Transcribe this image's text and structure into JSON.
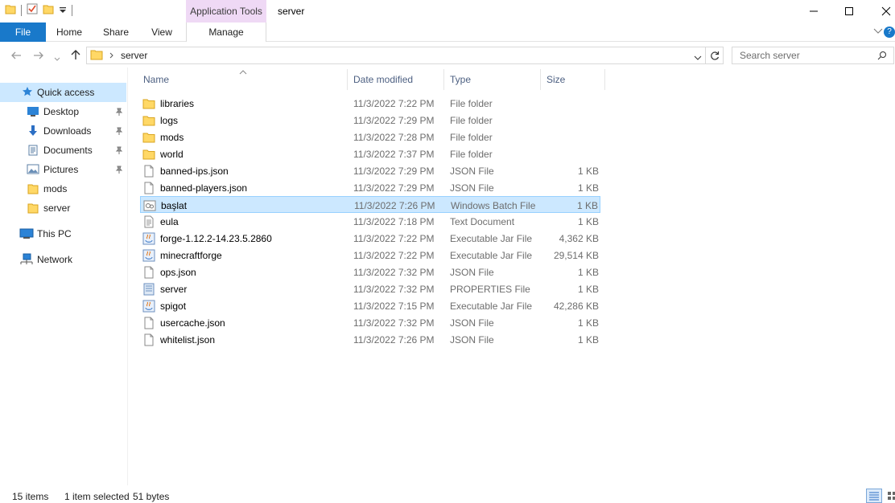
{
  "titlebar": {
    "context_tab": "Application Tools",
    "window_title": "server"
  },
  "ribbon": {
    "tabs": [
      "File",
      "Home",
      "Share",
      "View"
    ],
    "manage": "Manage"
  },
  "address": {
    "path": "server",
    "search_placeholder": "Search server"
  },
  "sidebar": {
    "items": [
      {
        "label": "Quick access",
        "icon": "star-icon"
      },
      {
        "label": "Desktop",
        "icon": "desktop-icon",
        "pinned": true
      },
      {
        "label": "Downloads",
        "icon": "download-icon",
        "pinned": true
      },
      {
        "label": "Documents",
        "icon": "documents-icon",
        "pinned": true
      },
      {
        "label": "Pictures",
        "icon": "pictures-icon",
        "pinned": true
      },
      {
        "label": "mods",
        "icon": "folder-icon"
      },
      {
        "label": "server",
        "icon": "folder-icon"
      },
      {
        "label": "This PC",
        "icon": "computer-icon"
      },
      {
        "label": "Network",
        "icon": "network-icon"
      }
    ]
  },
  "columns": [
    "Name",
    "Date modified",
    "Type",
    "Size"
  ],
  "files": [
    {
      "name": "libraries",
      "date": "11/3/2022 7:22 PM",
      "type": "File folder",
      "size": "",
      "icon": "folder"
    },
    {
      "name": "logs",
      "date": "11/3/2022 7:29 PM",
      "type": "File folder",
      "size": "",
      "icon": "folder"
    },
    {
      "name": "mods",
      "date": "11/3/2022 7:28 PM",
      "type": "File folder",
      "size": "",
      "icon": "folder"
    },
    {
      "name": "world",
      "date": "11/3/2022 7:37 PM",
      "type": "File folder",
      "size": "",
      "icon": "folder"
    },
    {
      "name": "banned-ips.json",
      "date": "11/3/2022 7:29 PM",
      "type": "JSON File",
      "size": "1 KB",
      "icon": "file"
    },
    {
      "name": "banned-players.json",
      "date": "11/3/2022 7:29 PM",
      "type": "JSON File",
      "size": "1 KB",
      "icon": "file"
    },
    {
      "name": "başlat",
      "date": "11/3/2022 7:26 PM",
      "type": "Windows Batch File",
      "size": "1 KB",
      "icon": "batch",
      "selected": true
    },
    {
      "name": "eula",
      "date": "11/3/2022 7:18 PM",
      "type": "Text Document",
      "size": "1 KB",
      "icon": "text"
    },
    {
      "name": "forge-1.12.2-14.23.5.2860",
      "date": "11/3/2022 7:22 PM",
      "type": "Executable Jar File",
      "size": "4,362 KB",
      "icon": "jar"
    },
    {
      "name": "minecraftforge",
      "date": "11/3/2022 7:22 PM",
      "type": "Executable Jar File",
      "size": "29,514 KB",
      "icon": "jar"
    },
    {
      "name": "ops.json",
      "date": "11/3/2022 7:32 PM",
      "type": "JSON File",
      "size": "1 KB",
      "icon": "file"
    },
    {
      "name": "server",
      "date": "11/3/2022 7:32 PM",
      "type": "PROPERTIES File",
      "size": "1 KB",
      "icon": "properties"
    },
    {
      "name": "spigot",
      "date": "11/3/2022 7:15 PM",
      "type": "Executable Jar File",
      "size": "42,286 KB",
      "icon": "jar"
    },
    {
      "name": "usercache.json",
      "date": "11/3/2022 7:32 PM",
      "type": "JSON File",
      "size": "1 KB",
      "icon": "file"
    },
    {
      "name": "whitelist.json",
      "date": "11/3/2022 7:26 PM",
      "type": "JSON File",
      "size": "1 KB",
      "icon": "file"
    }
  ],
  "status": {
    "count": "15 items",
    "selection": "1 item selected",
    "bytes": "51 bytes"
  },
  "colors": {
    "accent": "#1979ca",
    "selection": "#cce8ff",
    "folder": "#ffd866"
  }
}
